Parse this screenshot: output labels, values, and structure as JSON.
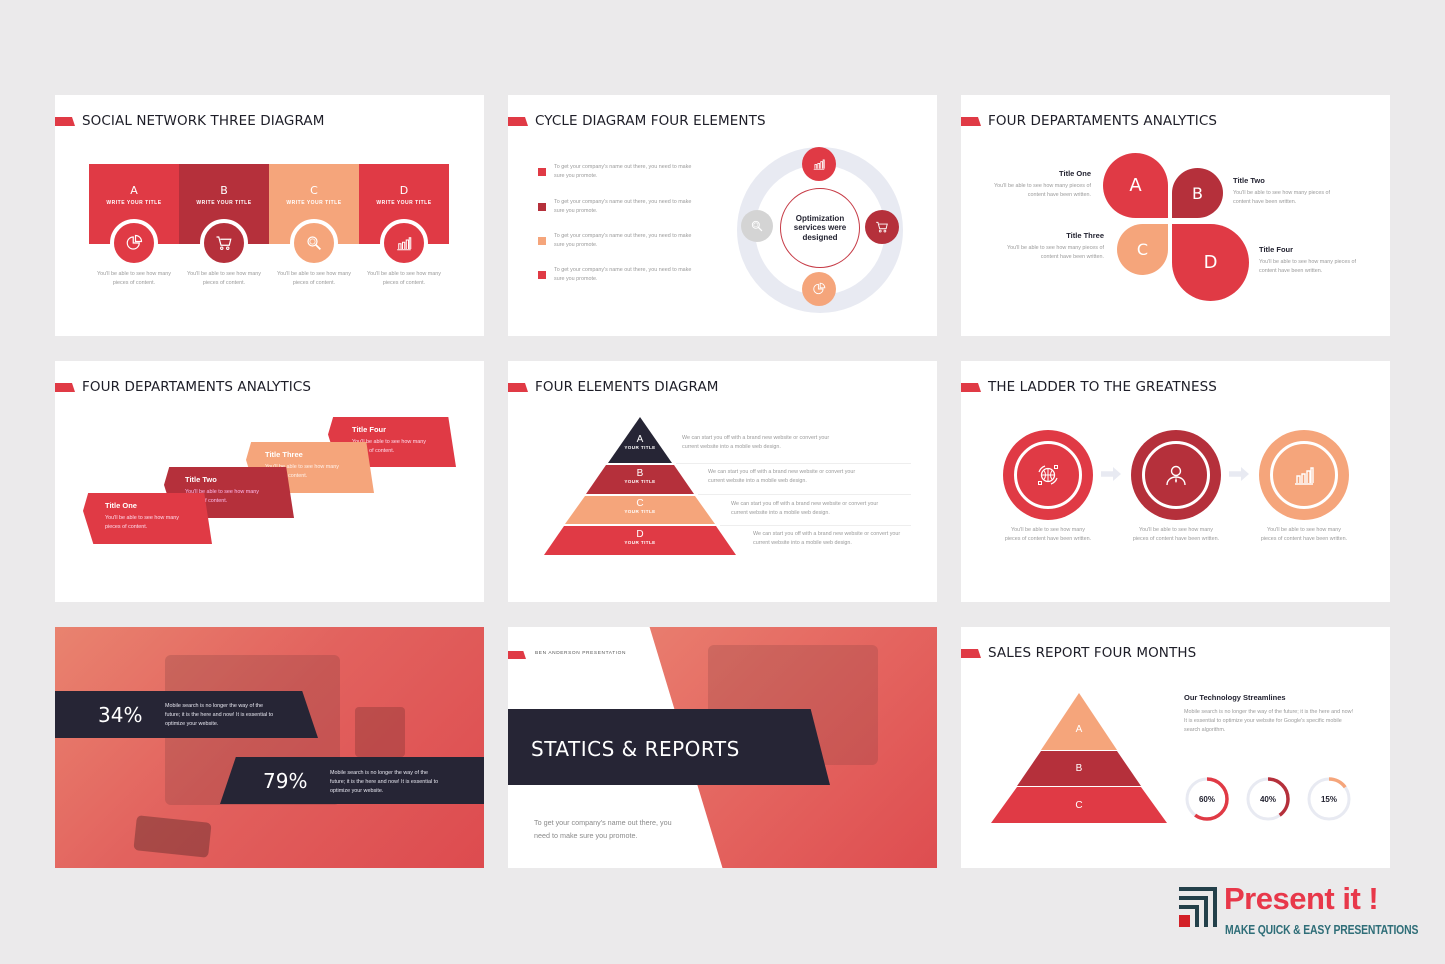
{
  "colors": {
    "red": "#e03a45",
    "dark_red": "#b5303b",
    "peach": "#f5a57b",
    "navy": "#262535",
    "light_gray_ring": "#e8eaf2",
    "background": "#ebeaeb"
  },
  "slides": [
    {
      "title": "SOCIAL NETWORK THREE DIAGRAM",
      "columns": [
        {
          "letter": "A",
          "subtitle": "WRITE YOUR TITLE",
          "icon": "pie-chart-icon",
          "text": "You'll be able to see how many pieces of content."
        },
        {
          "letter": "B",
          "subtitle": "WRITE YOUR TITLE",
          "icon": "shopping-cart-icon",
          "text": "You'll be able to see how many pieces of content."
        },
        {
          "letter": "C",
          "subtitle": "WRITE YOUR TITLE",
          "icon": "search-icon",
          "text": "You'll be able to see how many pieces of content."
        },
        {
          "letter": "D",
          "subtitle": "WRITE YOUR TITLE",
          "icon": "bar-chart-icon",
          "text": "You'll be able to see how many pieces of content."
        }
      ]
    },
    {
      "title": "CYCLE DIAGRAM FOUR ELEMENTS",
      "bullets": [
        "To get your company's name out there, you need to make sure you promote.",
        "To get your company's name out there, you need to make sure you promote.",
        "To get your company's name out there, you need to make sure you promote.",
        "To get your company's name out there, you need to make sure you promote."
      ],
      "center_text": "Optimization services were designed",
      "cycle_icons": [
        "bar-chart-icon",
        "shopping-cart-icon",
        "pie-chart-icon",
        "search-icon"
      ]
    },
    {
      "title": "FOUR DEPARTAMENTS ANALYTICS",
      "petals": [
        {
          "letter": "A",
          "title": "Title One",
          "text": "You'll be able to see how many pieces of content have been written."
        },
        {
          "letter": "B",
          "title": "Title Two",
          "text": "You'll be able to see how many pieces of content have been written."
        },
        {
          "letter": "C",
          "title": "Title Three",
          "text": "You'll be able to see how many pieces of content have been written."
        },
        {
          "letter": "D",
          "title": "Title Four",
          "text": "You'll be able to see how many pieces of content have been written."
        }
      ]
    },
    {
      "title": "FOUR DEPARTAMENTS ANALYTICS",
      "steps": [
        {
          "title": "Title One",
          "text": "You'll be able to see how many pieces of content."
        },
        {
          "title": "Title Two",
          "text": "You'll be able to see how many pieces of content."
        },
        {
          "title": "Title Three",
          "text": "You'll be able to see how many pieces of content."
        },
        {
          "title": "Title Four",
          "text": "You'll be able to see how many pieces of content."
        }
      ]
    },
    {
      "title": "FOUR ELEMENTS DIAGRAM",
      "levels": [
        {
          "letter": "A",
          "subtitle": "YOUR TITLE",
          "text": "We can start you off with a brand new website or convert your current website into a mobile web design."
        },
        {
          "letter": "B",
          "subtitle": "YOUR TITLE",
          "text": "We can start you off with a brand new website or convert your current website into a mobile web design."
        },
        {
          "letter": "C",
          "subtitle": "YOUR TITLE",
          "text": "We can start you off with a brand new website or convert your current website into a mobile web design."
        },
        {
          "letter": "D",
          "subtitle": "YOUR TITLE",
          "text": "We can start you off with a brand new website or convert your current website into a mobile web design."
        }
      ]
    },
    {
      "title": "THE LADDER TO THE GREATNESS",
      "steps": [
        {
          "icon": "globe-icon",
          "text": "You'll be able to see how many pieces of content have been written."
        },
        {
          "icon": "person-icon",
          "text": "You'll be able to see how many pieces of content have been written."
        },
        {
          "icon": "bar-chart-icon",
          "text": "You'll be able to see how many pieces of content have been written."
        }
      ]
    },
    {
      "stats": [
        {
          "value": "34%",
          "text": "Mobile search is no longer the way of the future; it is the here and now! It is essential to optimize your website."
        },
        {
          "value": "79%",
          "text": "Mobile search is no longer the way of the future; it is the here and now! It is essential to optimize your website."
        }
      ]
    },
    {
      "kicker": "BEN ANDERSON PRESENTATION",
      "title": "STATICS & REPORTS",
      "text": "To get your company's name out there, you need to make sure you promote."
    },
    {
      "title": "SALES REPORT FOUR MONTHS",
      "pyramid": [
        "A",
        "B",
        "C"
      ],
      "heading": "Our Technology Streamlines",
      "text": "Mobile search is no longer the way of the future; it is the here and now! It is essential to optimize your website for Google's specific mobile search algorithm.",
      "rings": [
        {
          "label": "60%",
          "value": 0.6,
          "color": "#e03a45"
        },
        {
          "label": "40%",
          "value": 0.4,
          "color": "#b5303b"
        },
        {
          "label": "15%",
          "value": 0.15,
          "color": "#f5a57b"
        }
      ]
    }
  ],
  "brand": {
    "name": "Present it !",
    "tagline": "MAKE QUICK & EASY PRESENTATIONS"
  }
}
